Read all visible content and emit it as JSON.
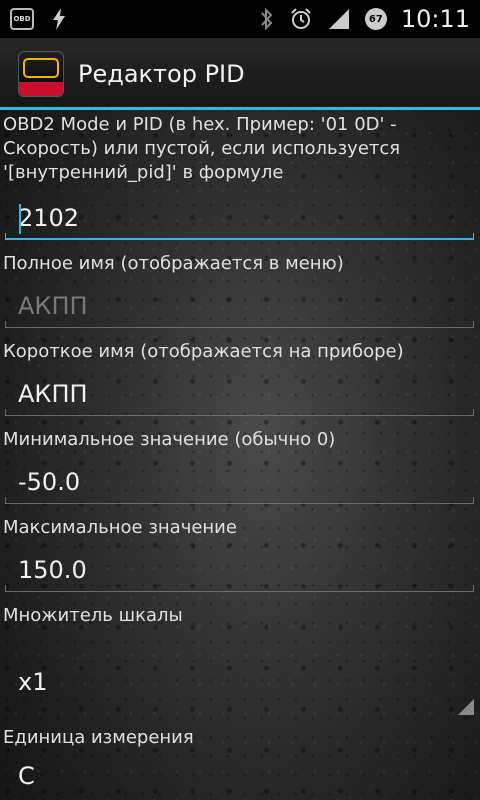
{
  "status_bar": {
    "obd_icon_label": "OBD",
    "time": "10:11",
    "battery_badge": "67",
    "icons": [
      "obd-icon",
      "flash-icon",
      "bluetooth-icon",
      "alarm-icon",
      "signal-icon"
    ]
  },
  "action_bar": {
    "title": "Редактор PID"
  },
  "form": {
    "pid_label": "OBD2 Mode и PID (в hex. Пример: '01 0D' - Скорость) или пустой, если используется '[внутренний_pid]' в формуле",
    "pid_value": "2102",
    "full_name_label": "Полное имя (отображается в меню)",
    "full_name_value": "АКПП",
    "short_name_label": "Короткое имя (отображается на приборе)",
    "short_name_value": "АКПП",
    "min_label": "Минимальное значение (обычно 0)",
    "min_value": "-50.0",
    "max_label": "Максимальное значение",
    "max_value": "150.0",
    "scale_label": "Множитель шкалы",
    "scale_value": "x1",
    "unit_label": "Единица измерения",
    "unit_value": "C"
  },
  "colors": {
    "accent": "#33b5e5",
    "check_red": "#c8102e",
    "obd_yellow": "#f6b300"
  }
}
